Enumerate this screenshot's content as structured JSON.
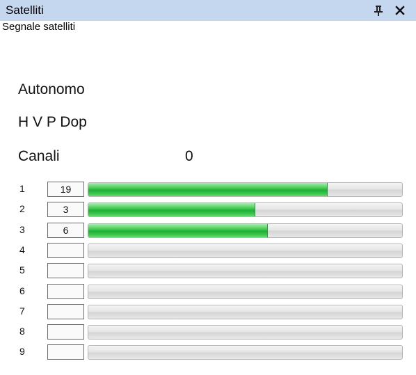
{
  "window": {
    "title": "Satelliti",
    "subtitle": "Segnale satelliti"
  },
  "info": {
    "mode": "Autonomo",
    "dop_label": "H V P Dop",
    "channels_label": "Canali",
    "channels_value": "0"
  },
  "satellites": [
    {
      "index": "1",
      "snr": "19",
      "level": 0.76
    },
    {
      "index": "2",
      "snr": "3",
      "level": 0.53
    },
    {
      "index": "3",
      "snr": "6",
      "level": 0.57
    },
    {
      "index": "4",
      "snr": "",
      "level": 0
    },
    {
      "index": "5",
      "snr": "",
      "level": 0
    },
    {
      "index": "6",
      "snr": "",
      "level": 0
    },
    {
      "index": "7",
      "snr": "",
      "level": 0
    },
    {
      "index": "8",
      "snr": "",
      "level": 0
    },
    {
      "index": "9",
      "snr": "",
      "level": 0
    }
  ],
  "colors": {
    "titlebar": "#c5d7ee",
    "bar_fill": "#1fae35"
  },
  "icons": {
    "pin": "pin-icon",
    "close": "close-icon"
  }
}
